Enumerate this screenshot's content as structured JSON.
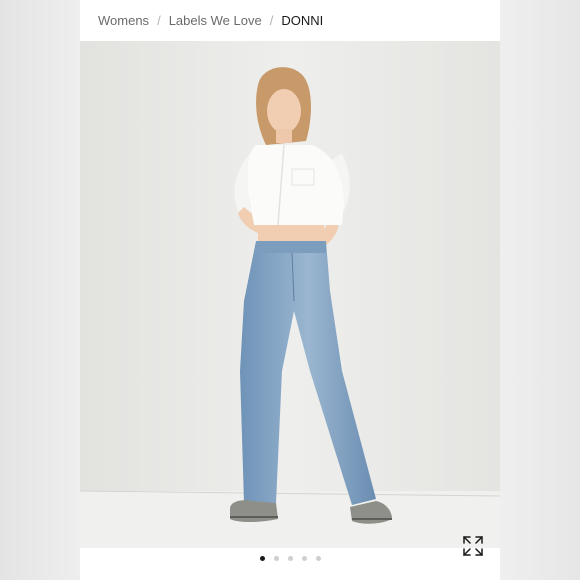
{
  "breadcrumb": {
    "items": [
      {
        "label": "Womens"
      },
      {
        "label": "Labels We Love"
      }
    ],
    "separator": "/",
    "current": "DONNI"
  },
  "gallery": {
    "slide_count": 5,
    "active_index": 0,
    "expand_icon": "expand-icon"
  },
  "colors": {
    "background": "#ffffff",
    "text": "#6b6b6b",
    "current_text": "#1a1a1a",
    "dot_active": "#1a1a1a",
    "dot_inactive": "#cfcfcf"
  }
}
